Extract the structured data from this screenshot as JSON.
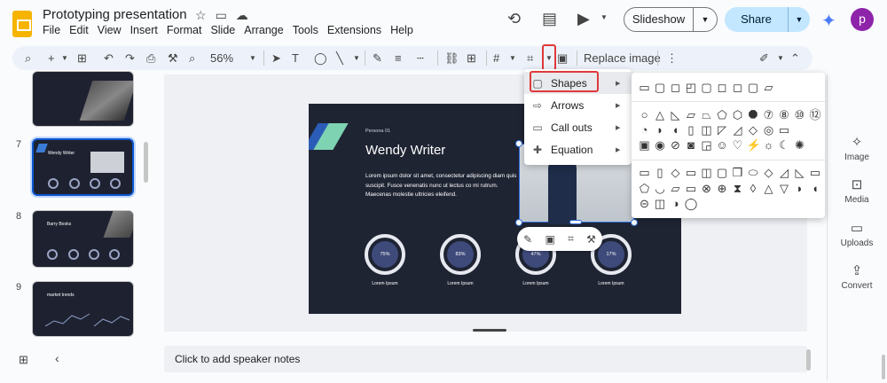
{
  "app": {
    "doc_title": "Prototyping presentation",
    "avatar_letter": "p",
    "colors": {
      "accent": "#0b57d0",
      "share_bg": "#c2e7ff",
      "highlight": "#e0393b",
      "slide_bg": "#1f2433",
      "logo": "#f6b400"
    }
  },
  "title_icons": [
    "star-icon",
    "folder-move-icon",
    "cloud-status-icon"
  ],
  "menu": [
    "File",
    "Edit",
    "View",
    "Insert",
    "Format",
    "Slide",
    "Arrange",
    "Tools",
    "Extensions",
    "Help"
  ],
  "header": {
    "slideshow_label": "Slideshow",
    "share_label": "Share",
    "icons": [
      "history-icon",
      "comment-icon",
      "meet-icon",
      "gemini-icon"
    ]
  },
  "toolbar": {
    "zoom": "56%",
    "replace_image": "Replace image"
  },
  "filmstrip": {
    "slides": [
      {
        "num": "",
        "title": ""
      },
      {
        "num": "7",
        "title": "Wendy Writer"
      },
      {
        "num": "8",
        "title": "Barry Books"
      },
      {
        "num": "9",
        "title": "market trends"
      }
    ]
  },
  "slide": {
    "persona": "Persona 01",
    "name": "Wendy Writer",
    "body": "Lorem ipsum dolor sit amet, consectetur adipiscing diam quis suscipit. Fusce venenatis nunc ut lectus co mi rutrum. Maecenas molestie ultricies eleifend.",
    "stats": [
      {
        "value": "75%",
        "label": "Lorem Ipsum"
      },
      {
        "value": "83%",
        "label": "Lorem Ipsum"
      },
      {
        "value": "47%",
        "label": "Lorem Ipsum"
      },
      {
        "value": "17%",
        "label": "Lorem Ipsum"
      }
    ]
  },
  "notes": {
    "placeholder": "Click to add speaker notes"
  },
  "right_panel": [
    {
      "label": "Image",
      "icon": "image-sparkle-icon"
    },
    {
      "label": "Media",
      "icon": "media-icon"
    },
    {
      "label": "Uploads",
      "icon": "folder-icon"
    },
    {
      "label": "Convert",
      "icon": "convert-icon"
    }
  ],
  "dropdown": {
    "items": [
      {
        "label": "Shapes",
        "icon": "square-icon"
      },
      {
        "label": "Arrows",
        "icon": "arrow-right-icon"
      },
      {
        "label": "Call outs",
        "icon": "callout-icon"
      },
      {
        "label": "Equation",
        "icon": "plus-icon"
      }
    ]
  }
}
